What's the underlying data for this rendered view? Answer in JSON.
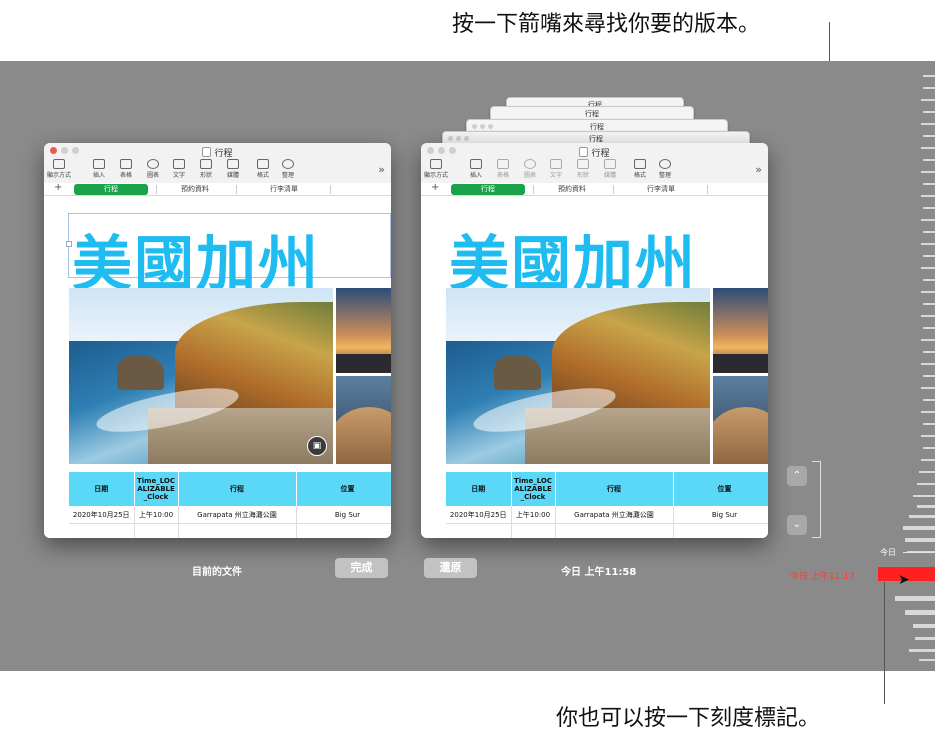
{
  "callouts": {
    "top": "按一下箭嘴來尋找你要的版本。",
    "bottom": "你也可以按一下刻度標記。"
  },
  "windows": {
    "title": "行程",
    "toolbar": [
      "顯示方式",
      "插入",
      "表格",
      "圖表",
      "文字",
      "形狀",
      "媒體",
      "格式",
      "整理"
    ],
    "tabs": [
      "行程",
      "預約資料",
      "行李清單"
    ],
    "doc_title": "美國加州",
    "table": {
      "headers": [
        "日期",
        "Time_LOCALIZABLE_Clock",
        "行程",
        "位置"
      ],
      "rows": [
        [
          "2020年10月25日",
          "上午10:00",
          "Garrapata 州立海灘公園",
          "Big Sur"
        ]
      ]
    }
  },
  "ghost_titles": [
    "行程",
    "行程",
    "行程",
    "行程"
  ],
  "bottom_bar": {
    "current_label": "目前的文件",
    "done_button": "完成",
    "restore_button": "還原",
    "version_time": "今日 上午11:58"
  },
  "timeline": {
    "today": "今日",
    "selected": "今日 上午11:17"
  },
  "icons": {
    "up_arrow": "chevron-up-icon",
    "down_arrow": "chevron-down-icon",
    "more": "chevron-double-right-icon",
    "media": "image-icon",
    "pointer": "mouse-pointer-icon"
  },
  "colors": {
    "accent_tab": "#1aa34a",
    "title_blue": "#1ebcf0",
    "table_header": "#5bd8f7",
    "timeline_red": "#ff2020",
    "background": "#8a8a8a"
  }
}
